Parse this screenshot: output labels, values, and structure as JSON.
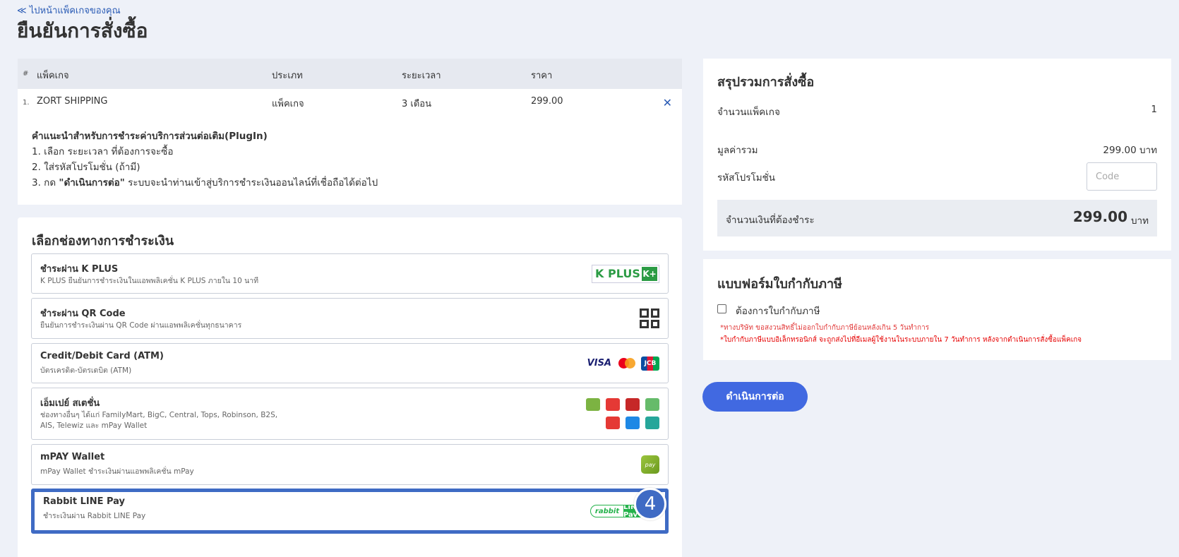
{
  "header": {
    "back_link": "≪ ไปหน้าแพ็คเกจของคุณ",
    "title": "ยืนยันการสั่งซื้อ"
  },
  "table": {
    "columns": [
      "#",
      "แพ็คเกจ",
      "ประเภท",
      "ระยะเวลา",
      "ราคา"
    ],
    "rows": [
      {
        "num": "1.",
        "package": "ZORT SHIPPING",
        "type": "แพ็คเกจ",
        "duration": "3 เดือน",
        "price": "299.00",
        "remove": "✕"
      }
    ]
  },
  "guide": {
    "title": "คำแนะนำสำหรับการชำระค่าบริการส่วนต่อเติม(PlugIn)",
    "step1": "1. เลือก ระยะเวลา ที่ต้องการจะซื้อ",
    "step2": "2. ใส่รหัสโปรโมชั่น (ถ้ามี)",
    "step3_prefix": "3. กด ",
    "step3_bold": "\"ดำเนินการต่อ\"",
    "step3_suffix": " ระบบจะนำท่านเข้าสู่บริการชำระเงินออนไลน์ที่เชื่อถือได้ต่อไป"
  },
  "payment": {
    "title": "เลือกช่องทางการชำระเงิน",
    "options": [
      {
        "title": "ชำระผ่าน K PLUS",
        "desc": "K PLUS ยืนยันการชำระเงินในแอพพลิเคชั่น K PLUS ภายใน 10 นาที"
      },
      {
        "title": "ชำระผ่าน QR Code",
        "desc": "ยืนยันการชำระเงินผ่าน QR Code ผ่านแอพพลิเคชั่นทุกธนาคาร"
      },
      {
        "title": "Credit/Debit Card (ATM)",
        "desc": "บัตรเครดิต-บัตรเดบิต (ATM)"
      },
      {
        "title": "เอ็มเปย์ สเตชั่น",
        "desc_line1": "ช่องทางอื่นๆ ได้แก่ FamilyMart, BigC, Central, Tops, Robinson, B2S,",
        "desc_line2": "AIS, Telewiz และ mPay Wallet"
      },
      {
        "title": "mPAY Wallet",
        "desc": "mPay Wallet ชำระเงินผ่านแอพพลิเคชั่น mPay"
      },
      {
        "title": "Rabbit LINE Pay",
        "desc": "ชำระเงินผ่าน Rabbit LINE Pay"
      }
    ],
    "logos": {
      "kplus_text": "K PLUS",
      "kplus_badge": "K+",
      "visa": "VISA",
      "jcb": "JCB",
      "mpay": "pay",
      "rabbit": "rabbit",
      "linepay": "LINE Pay"
    },
    "step_badge": "4"
  },
  "summary": {
    "title": "สรุปรวมการสั่งซื้อ",
    "count_label": "จำนวนแพ็คเกจ",
    "count_value": "1",
    "subtotal_label": "มูลค่ารวม",
    "subtotal_value": "299.00 บาท",
    "promo_label": "รหัสโปรโมชั่น",
    "promo_placeholder": "Code",
    "total_label": "จำนวนเงินที่ต้องชำระ",
    "total_value": "299.00",
    "total_unit": "บาท"
  },
  "tax": {
    "title": "แบบฟอร์มใบกำกับภาษี",
    "checkbox_label": "ต้องการใบกำกับภาษี",
    "note1": "*ทางบริษัท ขอสงวนสิทธิ์ไม่ออกใบกำกับภาษีย้อนหลังเกิน 5 วันทำการ",
    "note2": "*ใบกำกับภาษีแบบอิเล็กทรอนิกส์ จะถูกส่งไปที่อีเมลผู้ใช้งานในระบบภายใน 7 วันทำการ หลังจากดำเนินการสั่งซื้อแพ็คเกจ"
  },
  "actions": {
    "continue_label": "ดำเนินการต่อ"
  }
}
